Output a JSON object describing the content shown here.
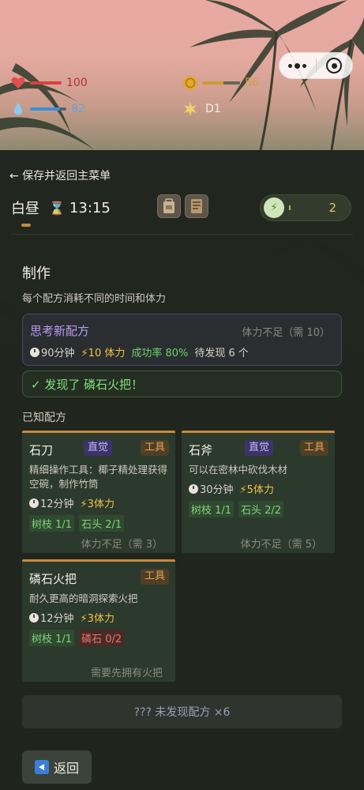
{
  "status": {
    "health": {
      "icon": "heart-icon",
      "value": "100",
      "fill": 1.0,
      "color": "#d94040"
    },
    "gold": {
      "icon": "coin-icon",
      "value": "56",
      "fill": 0.56,
      "color": "#d09a30"
    },
    "water": {
      "icon": "water-drop-icon",
      "value": "82",
      "fill": 0.82,
      "color": "#3a8fd8"
    },
    "day": {
      "icon": "sun-icon",
      "value": "D1"
    }
  },
  "nav": {
    "back_label": "← 保存并返回主菜单"
  },
  "time": {
    "period": "白昼",
    "icon": "hourglass-icon",
    "clock": "13:15"
  },
  "energy": {
    "icon": "lightning-icon",
    "value": "2"
  },
  "crafting": {
    "title": "制作",
    "subtitle": "每个配方消耗不同的时间和体力",
    "think": {
      "title": "思考新配方",
      "requirement": "体力不足（需 10）",
      "time": "90分钟",
      "stamina": "⚡10 体力",
      "success": "成功率 80%",
      "pending": "待发现 6 个"
    },
    "discovered": "✓ 发现了 磷石火把！",
    "known_title": "已知配方",
    "recipes": [
      {
        "name": "石刀",
        "badges": [
          "直觉",
          "工具"
        ],
        "desc": "精细操作工具：椰子精处理获得空碗，制作竹筒",
        "time": "12分钟",
        "stamina": "⚡3体力",
        "materials": [
          {
            "label": "树枝 1/1",
            "ok": true
          },
          {
            "label": "石头 2/1",
            "ok": true
          }
        ],
        "footer": "体力不足（需 3）"
      },
      {
        "name": "石斧",
        "badges": [
          "直觉",
          "工具"
        ],
        "desc": "可以在密林中砍伐木材",
        "time": "30分钟",
        "stamina": "⚡5体力",
        "materials": [
          {
            "label": "树枝 1/1",
            "ok": true
          },
          {
            "label": "石头 2/2",
            "ok": true
          }
        ],
        "footer": "体力不足（需 5）"
      },
      {
        "name": "磷石火把",
        "badges": [
          "工具"
        ],
        "desc": "耐久更高的暗洞探索火把",
        "time": "12分钟",
        "stamina": "⚡3体力",
        "materials": [
          {
            "label": "树枝 1/1",
            "ok": true
          },
          {
            "label": "磷石 0/2",
            "ok": false
          }
        ],
        "footer": "需要先拥有火把"
      }
    ],
    "unknown": "??? 未发现配方 ×6"
  },
  "footer": {
    "back_button": "返回"
  }
}
